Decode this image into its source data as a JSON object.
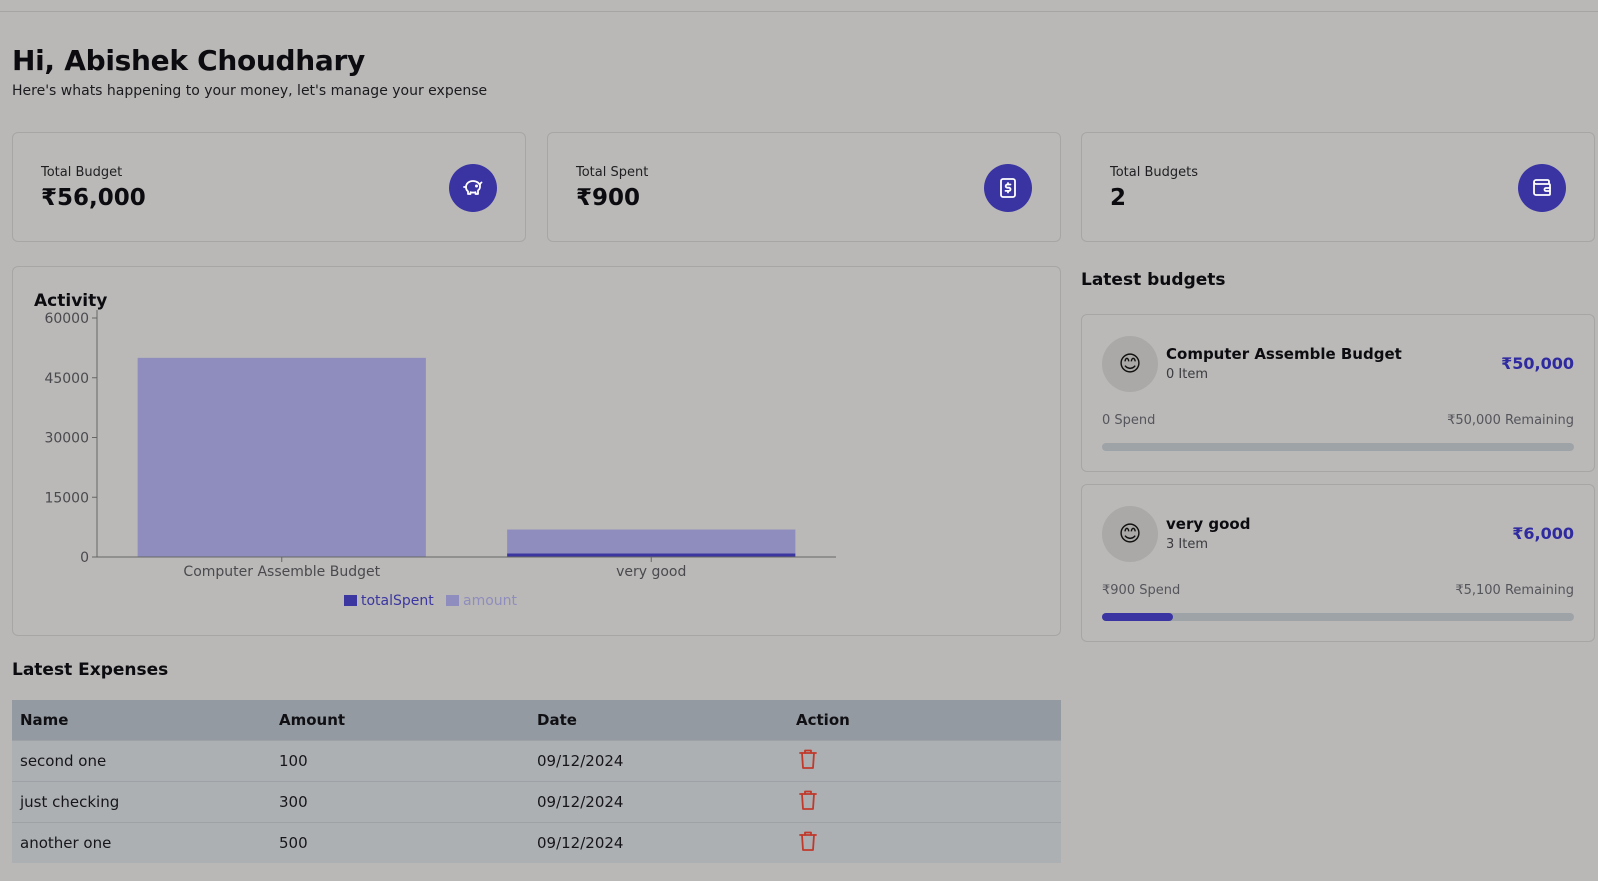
{
  "greeting": {
    "title": "Hi, Abishek Choudhary",
    "subtitle": "Here's whats happening to your money, let's manage your expense"
  },
  "stats": [
    {
      "label": "Total Budget",
      "value": "₹56,000",
      "icon": "piggy-bank-icon"
    },
    {
      "label": "Total Spent",
      "value": "₹900",
      "icon": "receipt-dollar-icon"
    },
    {
      "label": "Total Budgets",
      "value": "2",
      "icon": "wallet-icon"
    }
  ],
  "colors": {
    "accent": "#3a34a3",
    "amount_bar": "#8f8dbd",
    "spent_bar": "#3b36a0",
    "delete": "#c0392b"
  },
  "activity": {
    "title": "Activity"
  },
  "chart_data": {
    "type": "bar",
    "title": "Activity",
    "categories": [
      "Computer Assemble Budget",
      "very good"
    ],
    "series": [
      {
        "name": "totalSpent",
        "values": [
          0,
          900
        ]
      },
      {
        "name": "amount",
        "values": [
          50000,
          6000
        ]
      }
    ],
    "stacked": true,
    "ylim": [
      0,
      60000
    ],
    "yticks": [
      "0",
      "15000",
      "30000",
      "45000",
      "60000"
    ],
    "legend": "bottom-center",
    "grid": false
  },
  "latest_budgets": {
    "title": "Latest budgets",
    "items": [
      {
        "emoji": "😊",
        "name": "Computer Assemble Budget",
        "items": "0 Item",
        "amount": "₹50,000",
        "spend": "0 Spend",
        "remaining": "₹50,000 Remaining",
        "progress": 0
      },
      {
        "emoji": "😊",
        "name": "very good",
        "items": "3 Item",
        "amount": "₹6,000",
        "spend": "₹900 Spend",
        "remaining": "₹5,100 Remaining",
        "progress": 0.15
      }
    ]
  },
  "latest_expenses": {
    "title": "Latest Expenses",
    "columns": [
      "Name",
      "Amount",
      "Date",
      "Action"
    ],
    "rows": [
      {
        "name": "second one",
        "amount": "100",
        "date": "09/12/2024",
        "action": "trash-icon"
      },
      {
        "name": "just checking",
        "amount": "300",
        "date": "09/12/2024",
        "action": "trash-icon"
      },
      {
        "name": "another one",
        "amount": "500",
        "date": "09/12/2024",
        "action": "trash-icon"
      }
    ]
  }
}
